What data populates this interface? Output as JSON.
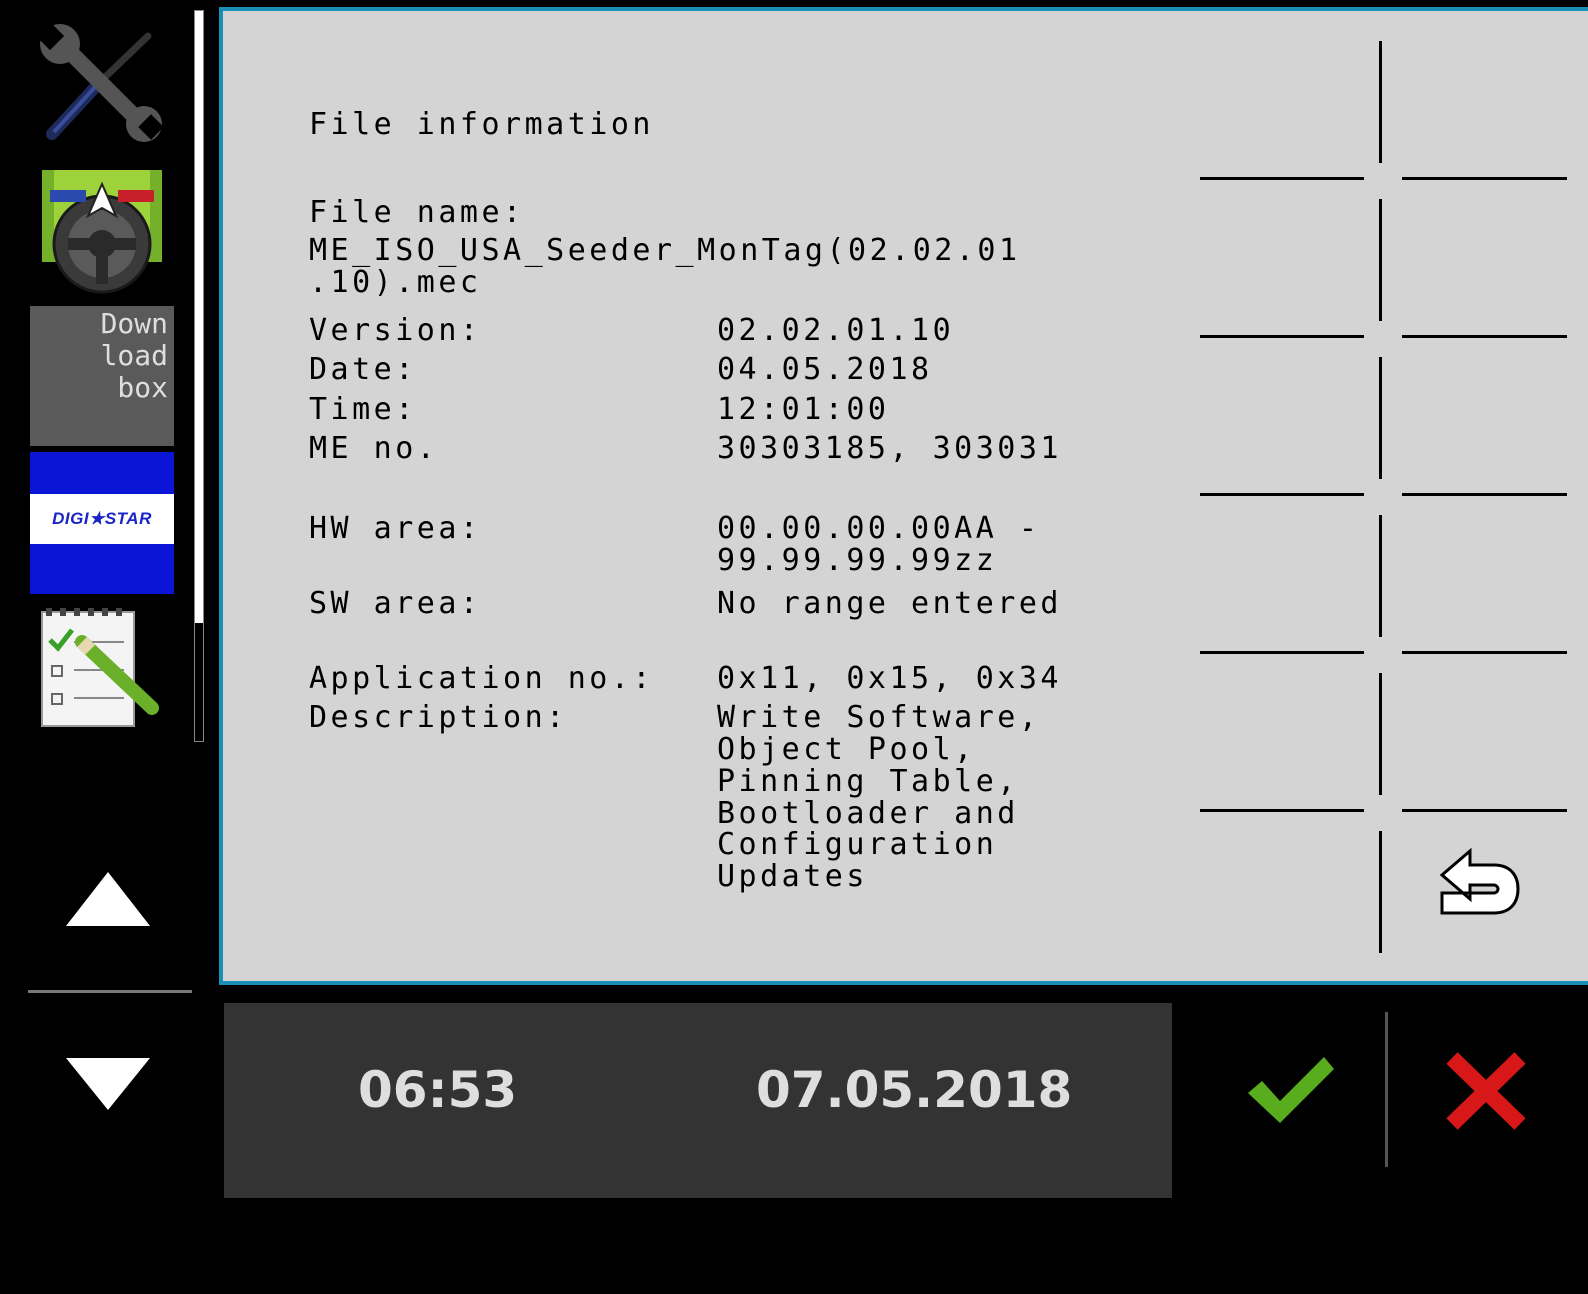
{
  "sidebar": {
    "download_box_label": "Down\nload\n box",
    "digistar_label": "DIGI★STAR"
  },
  "file_info": {
    "title": "File information",
    "file_name_label": "File name:",
    "file_name_line1": "ME_ISO_USA_Seeder_MonTag(02.02.01",
    "file_name_line2": ".10).mec",
    "version_label": "Version:",
    "version_value": "02.02.01.10",
    "date_label": "Date:",
    "date_value": "04.05.2018",
    "time_label": "Time:",
    "time_value": "12:01:00",
    "me_no_label": "ME no.",
    "me_no_value": "30303185, 303031",
    "hw_area_label": "HW area:",
    "hw_area_line1": "00.00.00.00AA -",
    "hw_area_line2": "99.99.99.99zz",
    "sw_area_label": "SW area:",
    "sw_area_value": "No range entered",
    "application_no_label": "Application no.:",
    "application_no_value": "0x11, 0x15, 0x34",
    "description_label": "Description:",
    "description_lines": [
      "Write Software,",
      "Object Pool,",
      "Pinning Table,",
      "Bootloader and",
      "Configuration",
      "Updates"
    ]
  },
  "footer": {
    "time": "06:53",
    "date": "07.05.2018"
  },
  "colors": {
    "panel_bg": "#d4d4d4",
    "panel_border": "#1a8fb5",
    "footer_bg": "#333333",
    "ok_green": "#5aac1f",
    "cancel_red": "#d81818"
  }
}
